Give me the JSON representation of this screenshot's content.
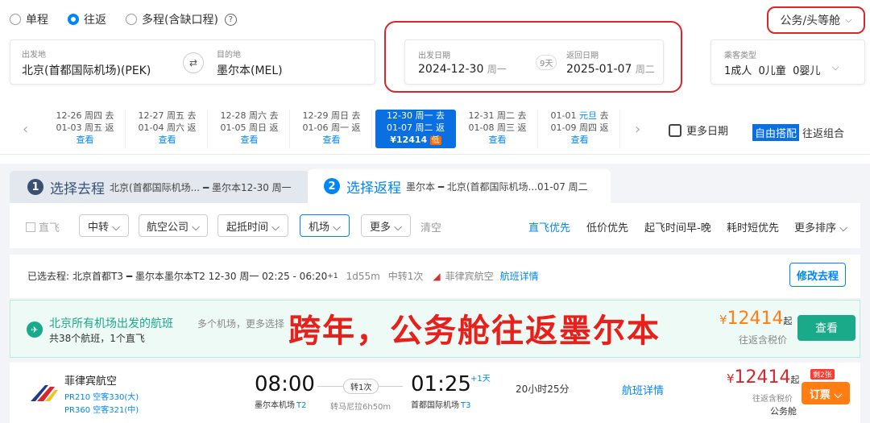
{
  "trip_type": {
    "options": [
      "单程",
      "往返",
      "多程(含缺口程)"
    ],
    "selected": "往返",
    "help": "?"
  },
  "cabin": {
    "label": "公务/头等舱",
    "arrow": "⌵"
  },
  "search": {
    "from_label": "出发地",
    "from_value": "北京(首都国际机场)(PEK)",
    "to_label": "目的地",
    "to_value": "墨尔本(MEL)",
    "swap": "⇄",
    "depart_label": "出发日期",
    "depart_date": "2024-12-30",
    "depart_weekday": "周一",
    "days": "9天",
    "return_label": "返回日期",
    "return_date": "2025-01-07",
    "return_weekday": "周二",
    "pax_label": "乘客类型",
    "pax_value": "1成人  0儿童  0婴儿",
    "pax_arrow": "⌵"
  },
  "date_bar": {
    "prev": "‹",
    "next": "›",
    "items": [
      {
        "out": "12-26 周四 去",
        "ret": "01-03 周五 返",
        "price": "查看"
      },
      {
        "out": "12-27 周五 去",
        "ret": "01-04 周六 返",
        "price": "查看"
      },
      {
        "out": "12-28 周六 去",
        "ret": "01-05 周日 返",
        "price": "查看"
      },
      {
        "out": "12-29 周日 去",
        "ret": "01-06 周一 返",
        "price": "查看"
      },
      {
        "out": "12-30 周一 去",
        "ret": "01-07 周二 返",
        "price": "¥12414",
        "tag": "低"
      },
      {
        "out": "12-31 周二 去",
        "ret": "01-08 周三 返",
        "price": "查看"
      },
      {
        "out_date": "01-01",
        "out_holiday": "元旦",
        "out_dir": "去",
        "ret": "01-09 周四 返",
        "price": "查看"
      }
    ],
    "more_dates": "更多日期",
    "free_tag": "自由搭配",
    "free_label": "往返组合"
  },
  "tabs": {
    "t1_num": "1",
    "t1_title": "选择去程",
    "t1_route": "北京(首都国际机场... ━ 墨尔本12-30 周一",
    "t2_num": "2",
    "t2_title": "选择返程",
    "t2_route": "墨尔本 ━ 北京(首都国际机场...01-07 周二"
  },
  "filters": {
    "direct": "直飞",
    "transfer": "中转 ⌵",
    "airline": "航空公司 ⌵",
    "time": "起抵时间 ⌵",
    "airport": "机场 ⌵",
    "more": "更多 ⌵",
    "clear": "清空",
    "sorts": [
      "直飞优先",
      "低价优先",
      "起飞时间早-晚",
      "耗时短优先",
      "更多排序 ⌵"
    ]
  },
  "selected_outbound": {
    "label": "已选去程:",
    "route": "北京首都T3 ━ 墨尔本墨尔本T2 12-30 周一 02:25 - 06:20",
    "plus": "+1",
    "duration": "1d55m",
    "stops": "中转1次",
    "airline": "菲律宾航空",
    "detail": "航班详情",
    "modify": "修改去程"
  },
  "all_airports": {
    "icon": "✈",
    "title": "北京所有机场出发的航班",
    "sub": "共38个航班，1个直飞",
    "hint": "多个机场，更多选择",
    "currency": "¥",
    "price": "12414",
    "qi": "起",
    "tax": "往返含税价",
    "view": "查看"
  },
  "overlay": "跨年，公务舱往返墨尔本",
  "flight": {
    "airline": "菲律宾航空",
    "code1": "PR210 空客330(大)",
    "code2": "PR360 空客321(中)",
    "dep_time": "08:00",
    "dep_airport": "墨尔本机场",
    "dep_term": "T2",
    "stops": "转1次",
    "via": "转马尼拉6h50m",
    "arr_time": "01:25",
    "plus": "+1天",
    "arr_airport": "首都国际机场",
    "arr_term": "T3",
    "duration": "20小时25分",
    "detail": "航班详情",
    "currency": "¥",
    "price": "12414",
    "qi": "起",
    "tax": "往返含税价",
    "cabin": "公务舱",
    "left": "剩2张",
    "book": "订票 ⌵"
  }
}
